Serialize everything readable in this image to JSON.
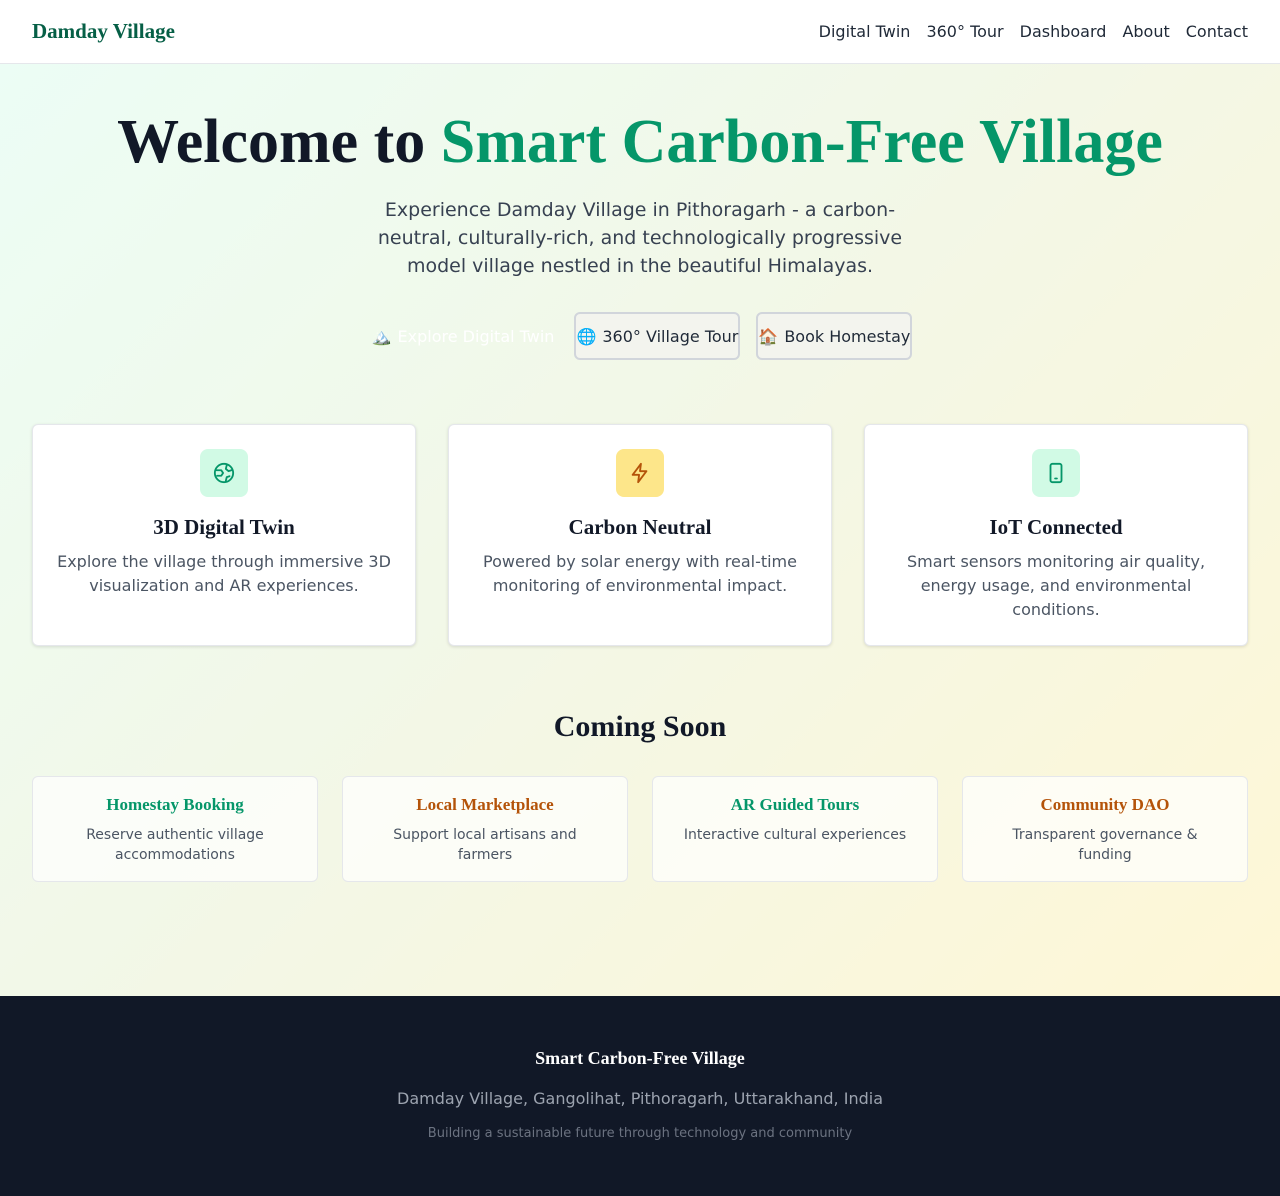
{
  "header": {
    "brand": "Damday Village",
    "nav": [
      "Digital Twin",
      "360° Tour",
      "Dashboard",
      "About",
      "Contact"
    ]
  },
  "hero": {
    "title_prefix": "Welcome to ",
    "title_accent": "Smart Carbon-Free Village",
    "subtitle": "Experience Damday Village in Pithoragarh - a carbon-neutral, culturally-rich, and technologically progressive model village nestled in the beautiful Himalayas.",
    "buttons": [
      {
        "icon": "🏔️",
        "label": "Explore Digital Twin"
      },
      {
        "icon": "🌐",
        "label": "360° Village Tour"
      },
      {
        "icon": "🏠",
        "label": "Book Homestay"
      }
    ]
  },
  "features": [
    {
      "icon": "globe-icon",
      "title": "3D Digital Twin",
      "desc": "Explore the village through immersive 3D visualization and AR experiences."
    },
    {
      "icon": "lightning-icon",
      "title": "Carbon Neutral",
      "desc": "Powered by solar energy with real-time monitoring of environmental impact."
    },
    {
      "icon": "smartphone-icon",
      "title": "IoT Connected",
      "desc": "Smart sensors monitoring air quality, energy usage, and environmental conditions."
    }
  ],
  "coming_soon": {
    "title": "Coming Soon",
    "items": [
      {
        "title": "Homestay Booking",
        "desc": "Reserve authentic village accommodations"
      },
      {
        "title": "Local Marketplace",
        "desc": "Support local artisans and farmers"
      },
      {
        "title": "AR Guided Tours",
        "desc": "Interactive cultural experiences"
      },
      {
        "title": "Community DAO",
        "desc": "Transparent governance & funding"
      }
    ]
  },
  "footer": {
    "title": "Smart Carbon-Free Village",
    "address": "Damday Village, Gangolihat, Pithoragarh, Uttarakhand, India",
    "tagline": "Building a sustainable future through technology and community"
  },
  "colors": {
    "brand": "#065f46",
    "accent": "#059669",
    "orange": "#b45309",
    "footer_bg": "#111827"
  }
}
